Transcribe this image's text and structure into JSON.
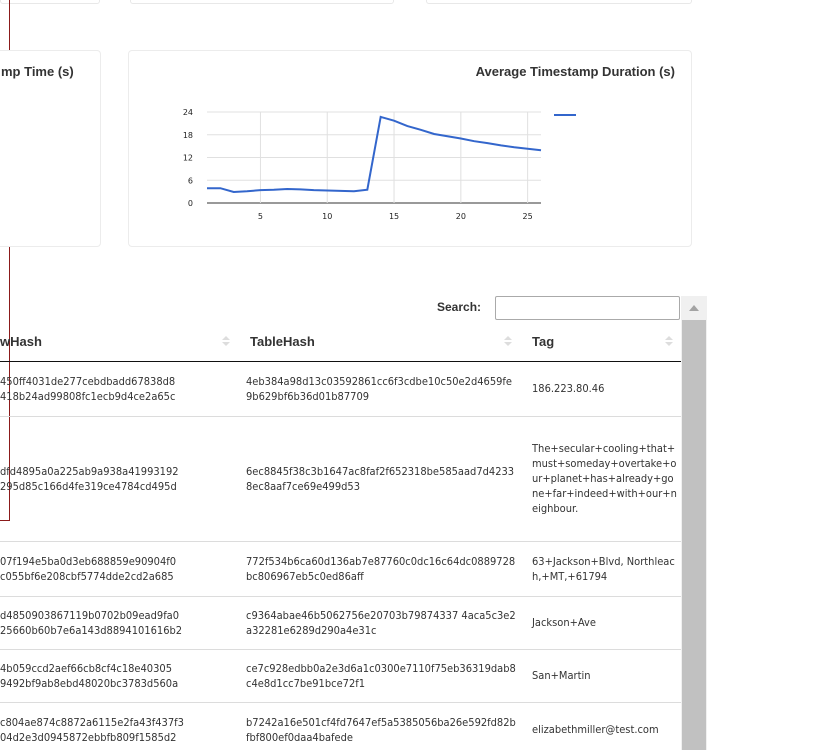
{
  "charts": {
    "left_title": "mp Time (s)",
    "right_title": "Average Timestamp Duration (s)"
  },
  "chart_data": {
    "type": "line",
    "title": "Average Timestamp Duration (s)",
    "xlabel": "",
    "ylabel": "",
    "x": [
      1,
      2,
      3,
      4,
      5,
      6,
      7,
      8,
      9,
      10,
      11,
      12,
      13,
      14,
      15,
      16,
      17,
      18,
      19,
      20,
      21,
      22,
      23,
      24,
      25,
      26
    ],
    "series": [
      {
        "values": [
          3.9,
          3.9,
          2.9,
          3.1,
          3.4,
          3.5,
          3.7,
          3.6,
          3.4,
          3.3,
          3.2,
          3.1,
          3.5,
          22.7,
          21.7,
          20.3,
          19.3,
          18.2,
          17.6,
          17.0,
          16.3,
          15.8,
          15.2,
          14.7,
          14.3,
          13.9
        ]
      }
    ],
    "xticks": [
      "5",
      "10",
      "15",
      "20",
      "25"
    ],
    "yticks": [
      "0",
      "6",
      "12",
      "18",
      "24"
    ],
    "xlim": [
      1,
      26
    ],
    "ylim": [
      0,
      24
    ],
    "grid": true,
    "color": "#3366cc",
    "legend": "right"
  },
  "search": {
    "label": "Search:",
    "value": ""
  },
  "table": {
    "headers": {
      "row_hash": "wHash",
      "table_hash": "TableHash",
      "tag": "Tag"
    },
    "rows": [
      {
        "row_hash": [
          "450ff4031de277cebdbadd67838d8",
          "418b24ad99808fc1ecb9d4ce2a65c"
        ],
        "table_hash": "4eb384a98d13c03592861cc6f3cdbe10c50e2d4659fe9b629bf6b36d01b87709",
        "tag": "186.223.80.46"
      },
      {
        "row_hash": [
          "dfd4895a0a225ab9a938a41993192",
          "295d85c166d4fe319ce4784cd495d"
        ],
        "table_hash": "6ec8845f38c3b1647ac8faf2f652318be585aad7d42338ec8aaf7ce69e499d53",
        "tag": "The+secular+cooling+that+must+someday+overtake+our+planet+has+already+gone+far+indeed+with+our+neighbour."
      },
      {
        "row_hash": [
          "07f194e5ba0d3eb688859e90904f0",
          "c055bf6e208cbf5774dde2cd2a685"
        ],
        "table_hash": "772f534b6ca60d136ab7e87760c0dc16c64dc0889728bc806967eb5c0ed86aff",
        "tag": "63+Jackson+Blvd, Northleach,+MT,+61794"
      },
      {
        "row_hash": [
          "d4850903867119b0702b09ead9fa0",
          "25660b60b7e6a143d8894101616b2"
        ],
        "table_hash": "c9364abae46b5062756e20703b79874337 4aca5c3e2a32281e6289d290a4e31c",
        "tag": "Jackson+Ave"
      },
      {
        "row_hash": [
          "4b059ccd2aef66cb8cf4c18e40305",
          "9492bf9ab8ebd48020bc3783d560a"
        ],
        "table_hash": "ce7c928edbb0a2e3d6a1c0300e7110f75eb36319dab8c4e8d1cc7be91bce72f1",
        "tag": "San+Martin"
      },
      {
        "row_hash": [
          "c804ae874c8872a6115e2fa43f437f3",
          "04d2e3d0945872ebbfb809f1585d2"
        ],
        "table_hash": "b7242a16e501cf4fd7647ef5a5385056ba26e592fd82bfbf800ef0daa4bafede",
        "tag": "elizabethmiller@test.com"
      }
    ]
  }
}
